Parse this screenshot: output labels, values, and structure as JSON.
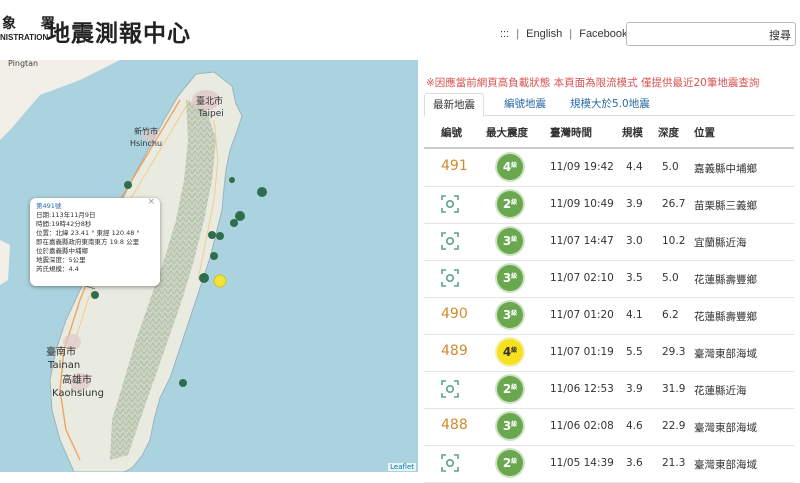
{
  "header": {
    "logo_line1": "象  署",
    "logo_line2": "NISTRATION",
    "title": "地震測報中心",
    "links": [
      ":::",
      "English",
      "Facebook"
    ],
    "search_placeholder": "",
    "search_button": "搜尋"
  },
  "map": {
    "labels": {
      "pingtan": "Pingtan",
      "taipei_zh": "臺北市",
      "taipei_en": "Taipei",
      "hsinchu_zh": "新竹市",
      "hsinchu_en": "Hsinchu",
      "tainan_zh": "臺南市",
      "tainan_en": "Tainan",
      "kaohsiung_zh": "高雄市",
      "kaohsiung_en": "Kaohsiung"
    },
    "popup": {
      "title": "第491號",
      "lines": [
        "日期:113年11月9日",
        "時間:19時42分8秒",
        "位置：北緯 23.41 ° 東經 120.48 °",
        "即在嘉義縣政府東南東方 19.8 公里",
        "位於嘉義縣中埔鄉",
        "地震深度：5公里",
        "芮氏規模：4.4"
      ],
      "close": "×"
    },
    "attribution": "Leaflet"
  },
  "panel": {
    "notice": "※因應當前網頁高負載狀態 本頁面為限流模式 僅提供最近20筆地震查詢",
    "tabs": [
      "最新地震",
      "編號地震",
      "規模大於5.0地震"
    ],
    "columns": [
      "編號",
      "最大震度",
      "臺灣時間",
      "規模",
      "深度",
      "位置"
    ],
    "rows": [
      {
        "id": "491",
        "intensity": "4",
        "time": "11/09 19:42",
        "mag": "4.4",
        "depth": "5.0",
        "loc": "嘉義縣中埔鄉",
        "color": "green"
      },
      {
        "id": "",
        "intensity": "2",
        "time": "11/09 10:49",
        "mag": "3.9",
        "depth": "26.7",
        "loc": "苗栗縣三義鄉",
        "color": "green"
      },
      {
        "id": "",
        "intensity": "3",
        "time": "11/07 14:47",
        "mag": "3.0",
        "depth": "10.2",
        "loc": "宜蘭縣近海",
        "color": "green"
      },
      {
        "id": "",
        "intensity": "3",
        "time": "11/07 02:10",
        "mag": "3.5",
        "depth": "5.0",
        "loc": "花蓮縣壽豐鄉",
        "color": "green"
      },
      {
        "id": "490",
        "intensity": "3",
        "time": "11/07 01:20",
        "mag": "4.1",
        "depth": "6.2",
        "loc": "花蓮縣壽豐鄉",
        "color": "green"
      },
      {
        "id": "489",
        "intensity": "4",
        "time": "11/07 01:19",
        "mag": "5.5",
        "depth": "29.3",
        "loc": "臺灣東部海域",
        "color": "yellow"
      },
      {
        "id": "",
        "intensity": "2",
        "time": "11/06 12:53",
        "mag": "3.9",
        "depth": "31.9",
        "loc": "花蓮縣近海",
        "color": "green"
      },
      {
        "id": "488",
        "intensity": "3",
        "time": "11/06 02:08",
        "mag": "4.6",
        "depth": "22.9",
        "loc": "臺灣東部海域",
        "color": "green"
      },
      {
        "id": "",
        "intensity": "2",
        "time": "11/05 14:39",
        "mag": "3.6",
        "depth": "21.3",
        "loc": "臺灣東部海域",
        "color": "green"
      }
    ],
    "intensity_unit": "級",
    "colors": {
      "green": "#6aa84f",
      "yellow": "#f7e11f",
      "number": "#d08a2e",
      "link": "#2a6aa8",
      "notice": "#d9534f"
    }
  }
}
